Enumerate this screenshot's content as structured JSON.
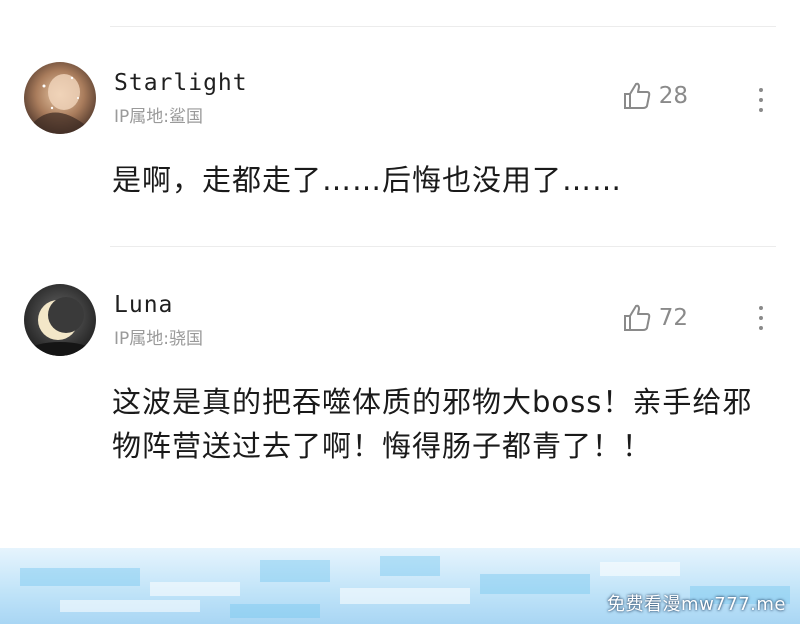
{
  "comments": [
    {
      "username": "Starlight",
      "ip_location": "IP属地:鲨国",
      "likes": "28",
      "text": "是啊，走都走了……后悔也没用了……",
      "avatar_icon": "starry-portrait-avatar"
    },
    {
      "username": "Luna",
      "ip_location": "IP属地:骁国",
      "likes": "72",
      "text": "这波是真的把吞噬体质的邪物大boss！亲手给邪物阵营送过去了啊！悔得肠子都青了！！",
      "avatar_icon": "crescent-moon-avatar"
    }
  ],
  "icons": {
    "like": "thumbs-up-icon",
    "more": "more-vertical-icon"
  },
  "colors": {
    "muted": "#8a8a8a",
    "banner": "#bfe3f8"
  },
  "watermark": "免费看漫mw777.me"
}
